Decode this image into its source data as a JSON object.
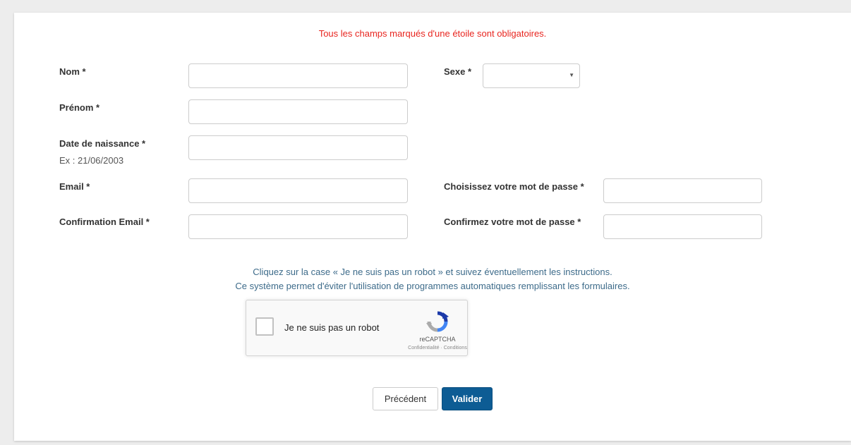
{
  "form": {
    "required_notice": "Tous les champs marqués d'une étoile sont obligatoires.",
    "nom_label": "Nom *",
    "nom_value": "",
    "prenom_label": "Prénom *",
    "prenom_value": "",
    "naissance_label": "Date de naissance *",
    "naissance_hint": "Ex : 21/06/2003",
    "naissance_value": "",
    "email_label": "Email *",
    "email_value": "",
    "email_confirm_label": "Confirmation Email *",
    "email_confirm_value": "",
    "sexe_label": "Sexe *",
    "sexe_value": "",
    "password_label": "Choisissez votre mot de passe *",
    "password_confirm_label": "Confirmez votre mot de passe *"
  },
  "captcha": {
    "instruction_line1": "Cliquez sur la case « Je ne suis pas un robot » et suivez éventuellement les instructions.",
    "instruction_line2": "Ce système permet d'éviter l'utilisation de programmes automatiques remplissant les formulaires.",
    "checkbox_label": "Je ne suis pas un robot",
    "brand": "reCAPTCHA",
    "links": "Confidentialité · Conditions",
    "icon": "recaptcha-logo-icon"
  },
  "actions": {
    "previous_label": "Précédent",
    "submit_label": "Valider"
  },
  "colors": {
    "notice": "#e8251f",
    "info_text": "#3d6b8a",
    "submit_bg": "#0d5c94",
    "recaptcha_blue": "#4a90e2"
  }
}
